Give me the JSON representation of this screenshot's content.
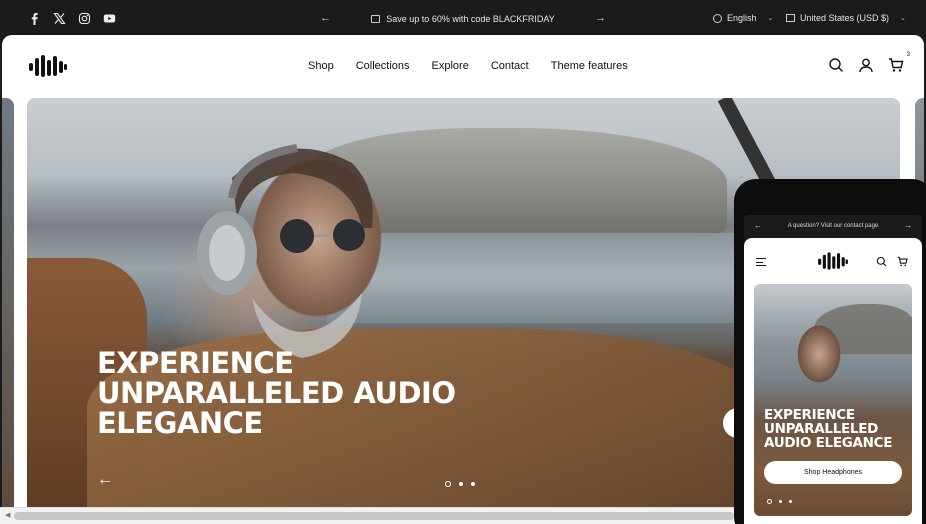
{
  "topbar": {
    "social": [
      "facebook-icon",
      "x-icon",
      "instagram-icon",
      "youtube-icon"
    ],
    "announcement": "Save up to 60% with code BLACKFRIDAY",
    "language": "English",
    "currency": "United States (USD $)"
  },
  "header": {
    "nav": [
      "Shop",
      "Collections",
      "Explore",
      "Contact",
      "Theme features"
    ],
    "cart_count": "3"
  },
  "hero": {
    "title": "EXPERIENCE UNPARALLELED AUDIO ELEGANCE",
    "slides_total": 3,
    "active_slide": 1
  },
  "mobile": {
    "announcement": "A question? Visit our contact page",
    "hero_title": "EXPERIENCE UNPARALLELED AUDIO ELEGANCE",
    "button": "Shop Headphones"
  },
  "colors": {
    "topbar_bg": "#1b1b1b",
    "panel_bg": "#ffffff",
    "text_dark": "#111111",
    "hero_text": "#ffffff"
  }
}
